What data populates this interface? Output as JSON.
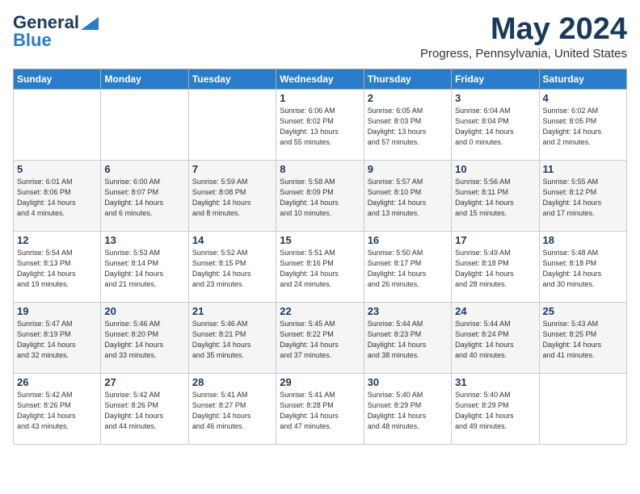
{
  "logo": {
    "line1": "General",
    "line2": "Blue"
  },
  "header": {
    "month": "May 2024",
    "location": "Progress, Pennsylvania, United States"
  },
  "days_of_week": [
    "Sunday",
    "Monday",
    "Tuesday",
    "Wednesday",
    "Thursday",
    "Friday",
    "Saturday"
  ],
  "weeks": [
    [
      {
        "day": "",
        "info": ""
      },
      {
        "day": "",
        "info": ""
      },
      {
        "day": "",
        "info": ""
      },
      {
        "day": "1",
        "info": "Sunrise: 6:06 AM\nSunset: 8:02 PM\nDaylight: 13 hours\nand 55 minutes."
      },
      {
        "day": "2",
        "info": "Sunrise: 6:05 AM\nSunset: 8:03 PM\nDaylight: 13 hours\nand 57 minutes."
      },
      {
        "day": "3",
        "info": "Sunrise: 6:04 AM\nSunset: 8:04 PM\nDaylight: 14 hours\nand 0 minutes."
      },
      {
        "day": "4",
        "info": "Sunrise: 6:02 AM\nSunset: 8:05 PM\nDaylight: 14 hours\nand 2 minutes."
      }
    ],
    [
      {
        "day": "5",
        "info": "Sunrise: 6:01 AM\nSunset: 8:06 PM\nDaylight: 14 hours\nand 4 minutes."
      },
      {
        "day": "6",
        "info": "Sunrise: 6:00 AM\nSunset: 8:07 PM\nDaylight: 14 hours\nand 6 minutes."
      },
      {
        "day": "7",
        "info": "Sunrise: 5:59 AM\nSunset: 8:08 PM\nDaylight: 14 hours\nand 8 minutes."
      },
      {
        "day": "8",
        "info": "Sunrise: 5:58 AM\nSunset: 8:09 PM\nDaylight: 14 hours\nand 10 minutes."
      },
      {
        "day": "9",
        "info": "Sunrise: 5:57 AM\nSunset: 8:10 PM\nDaylight: 14 hours\nand 13 minutes."
      },
      {
        "day": "10",
        "info": "Sunrise: 5:56 AM\nSunset: 8:11 PM\nDaylight: 14 hours\nand 15 minutes."
      },
      {
        "day": "11",
        "info": "Sunrise: 5:55 AM\nSunset: 8:12 PM\nDaylight: 14 hours\nand 17 minutes."
      }
    ],
    [
      {
        "day": "12",
        "info": "Sunrise: 5:54 AM\nSunset: 8:13 PM\nDaylight: 14 hours\nand 19 minutes."
      },
      {
        "day": "13",
        "info": "Sunrise: 5:53 AM\nSunset: 8:14 PM\nDaylight: 14 hours\nand 21 minutes."
      },
      {
        "day": "14",
        "info": "Sunrise: 5:52 AM\nSunset: 8:15 PM\nDaylight: 14 hours\nand 23 minutes."
      },
      {
        "day": "15",
        "info": "Sunrise: 5:51 AM\nSunset: 8:16 PM\nDaylight: 14 hours\nand 24 minutes."
      },
      {
        "day": "16",
        "info": "Sunrise: 5:50 AM\nSunset: 8:17 PM\nDaylight: 14 hours\nand 26 minutes."
      },
      {
        "day": "17",
        "info": "Sunrise: 5:49 AM\nSunset: 8:18 PM\nDaylight: 14 hours\nand 28 minutes."
      },
      {
        "day": "18",
        "info": "Sunrise: 5:48 AM\nSunset: 8:18 PM\nDaylight: 14 hours\nand 30 minutes."
      }
    ],
    [
      {
        "day": "19",
        "info": "Sunrise: 5:47 AM\nSunset: 8:19 PM\nDaylight: 14 hours\nand 32 minutes."
      },
      {
        "day": "20",
        "info": "Sunrise: 5:46 AM\nSunset: 8:20 PM\nDaylight: 14 hours\nand 33 minutes."
      },
      {
        "day": "21",
        "info": "Sunrise: 5:46 AM\nSunset: 8:21 PM\nDaylight: 14 hours\nand 35 minutes."
      },
      {
        "day": "22",
        "info": "Sunrise: 5:45 AM\nSunset: 8:22 PM\nDaylight: 14 hours\nand 37 minutes."
      },
      {
        "day": "23",
        "info": "Sunrise: 5:44 AM\nSunset: 8:23 PM\nDaylight: 14 hours\nand 38 minutes."
      },
      {
        "day": "24",
        "info": "Sunrise: 5:44 AM\nSunset: 8:24 PM\nDaylight: 14 hours\nand 40 minutes."
      },
      {
        "day": "25",
        "info": "Sunrise: 5:43 AM\nSunset: 8:25 PM\nDaylight: 14 hours\nand 41 minutes."
      }
    ],
    [
      {
        "day": "26",
        "info": "Sunrise: 5:42 AM\nSunset: 8:26 PM\nDaylight: 14 hours\nand 43 minutes."
      },
      {
        "day": "27",
        "info": "Sunrise: 5:42 AM\nSunset: 8:26 PM\nDaylight: 14 hours\nand 44 minutes."
      },
      {
        "day": "28",
        "info": "Sunrise: 5:41 AM\nSunset: 8:27 PM\nDaylight: 14 hours\nand 46 minutes."
      },
      {
        "day": "29",
        "info": "Sunrise: 5:41 AM\nSunset: 8:28 PM\nDaylight: 14 hours\nand 47 minutes."
      },
      {
        "day": "30",
        "info": "Sunrise: 5:40 AM\nSunset: 8:29 PM\nDaylight: 14 hours\nand 48 minutes."
      },
      {
        "day": "31",
        "info": "Sunrise: 5:40 AM\nSunset: 8:29 PM\nDaylight: 14 hours\nand 49 minutes."
      },
      {
        "day": "",
        "info": ""
      }
    ]
  ]
}
